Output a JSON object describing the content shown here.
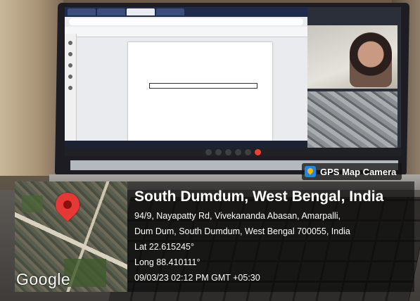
{
  "badge": {
    "label": "GPS Map Camera",
    "icon": "gps-map-camera-icon"
  },
  "location": {
    "title": "South Dumdum, West Bengal, India",
    "address_line1": "94/9, Nayapatty Rd, Vivekananda Abasan, Amarpalli,",
    "address_line2": "Dum Dum, South Dumdum, West Bengal 700055, India",
    "lat": "Lat 22.615245°",
    "long": "Long 88.410111°",
    "datetime": "09/03/23 02:12 PM GMT +05:30"
  },
  "map": {
    "watermark": "Google",
    "pin_color": "#e53935"
  },
  "colors": {
    "overlay_bg": "#0a0a0a",
    "badge_icon": "#1e88e5"
  }
}
